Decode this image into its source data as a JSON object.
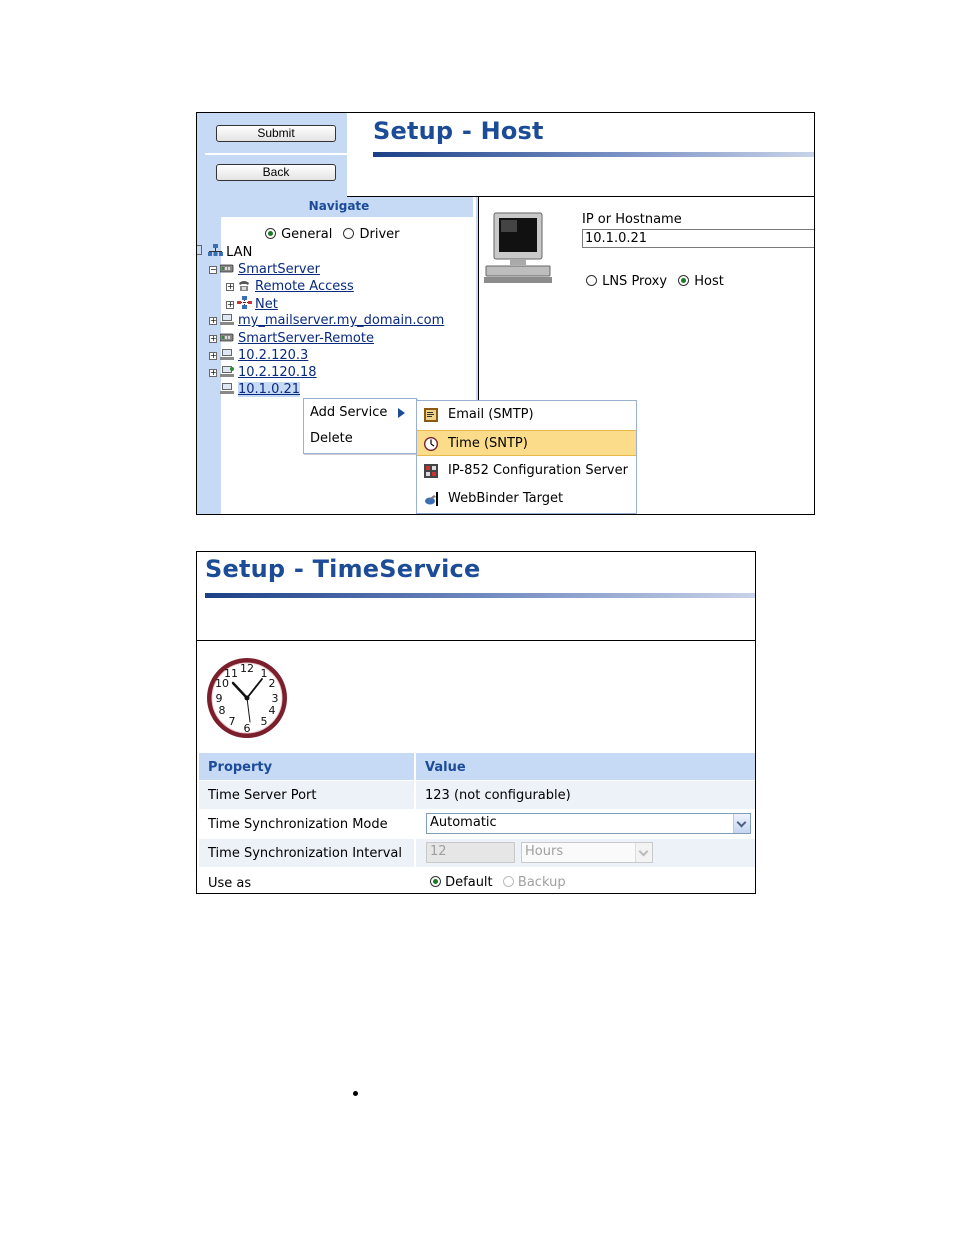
{
  "host_panel": {
    "submit_label": "Submit",
    "back_label": "Back",
    "title": "Setup - Host",
    "navigate_label": "Navigate",
    "view_options": [
      {
        "label": "General",
        "selected": true
      },
      {
        "label": "Driver",
        "selected": false
      }
    ],
    "tree": {
      "root": "LAN",
      "nodes": [
        {
          "label": "SmartServer",
          "toggle": "−",
          "icon": "smartserver-icon"
        },
        {
          "label": "Remote Access",
          "toggle": "+",
          "icon": "telephone-icon"
        },
        {
          "label": "Net",
          "toggle": "+",
          "icon": "network-icon"
        },
        {
          "label": "my_mailserver.my_domain.com",
          "toggle": "+",
          "icon": "computer-icon"
        },
        {
          "label": "SmartServer-Remote",
          "toggle": "+",
          "icon": "smartserver-icon"
        },
        {
          "label": "10.2.120.3",
          "toggle": "+",
          "icon": "computer-icon"
        },
        {
          "label": "10.2.120.18",
          "toggle": "+",
          "icon": "computer-icon"
        },
        {
          "label": "10.1.0.21",
          "toggle": "",
          "icon": "computer-icon",
          "selected": true
        }
      ]
    },
    "context_menu": {
      "items": [
        "Add Service",
        "Delete"
      ]
    },
    "submenu": {
      "items": [
        {
          "label": "Email (SMTP)",
          "icon": "email-icon"
        },
        {
          "label": "Time (SNTP)",
          "icon": "clock-icon",
          "highlighted": true
        },
        {
          "label": "IP-852 Configuration Server",
          "icon": "config-server-icon"
        },
        {
          "label": "WebBinder Target",
          "icon": "webbinder-icon"
        }
      ]
    },
    "ip_label": "IP or Hostname",
    "ip_value": "10.1.0.21",
    "mode_options": [
      {
        "label": "LNS Proxy",
        "selected": false
      },
      {
        "label": "Host",
        "selected": true
      }
    ]
  },
  "time_panel": {
    "title": "Setup - TimeService",
    "table": {
      "headers": [
        "Property",
        "Value"
      ],
      "rows": [
        {
          "property": "Time Server Port",
          "value": "123 (not configurable)"
        },
        {
          "property": "Time Synchronization Mode",
          "value": "Automatic"
        },
        {
          "property": "Time Synchronization Interval",
          "interval_value": "12",
          "interval_unit": "Hours"
        },
        {
          "property": "Use as",
          "options": [
            {
              "label": "Default",
              "selected": true,
              "disabled": false
            },
            {
              "label": "Backup",
              "selected": false,
              "disabled": true
            }
          ]
        }
      ]
    }
  },
  "colors": {
    "title_blue": "#1c4c97",
    "panel_blue": "#c6d9f5",
    "menu_highlight": "#fbdc8a"
  }
}
